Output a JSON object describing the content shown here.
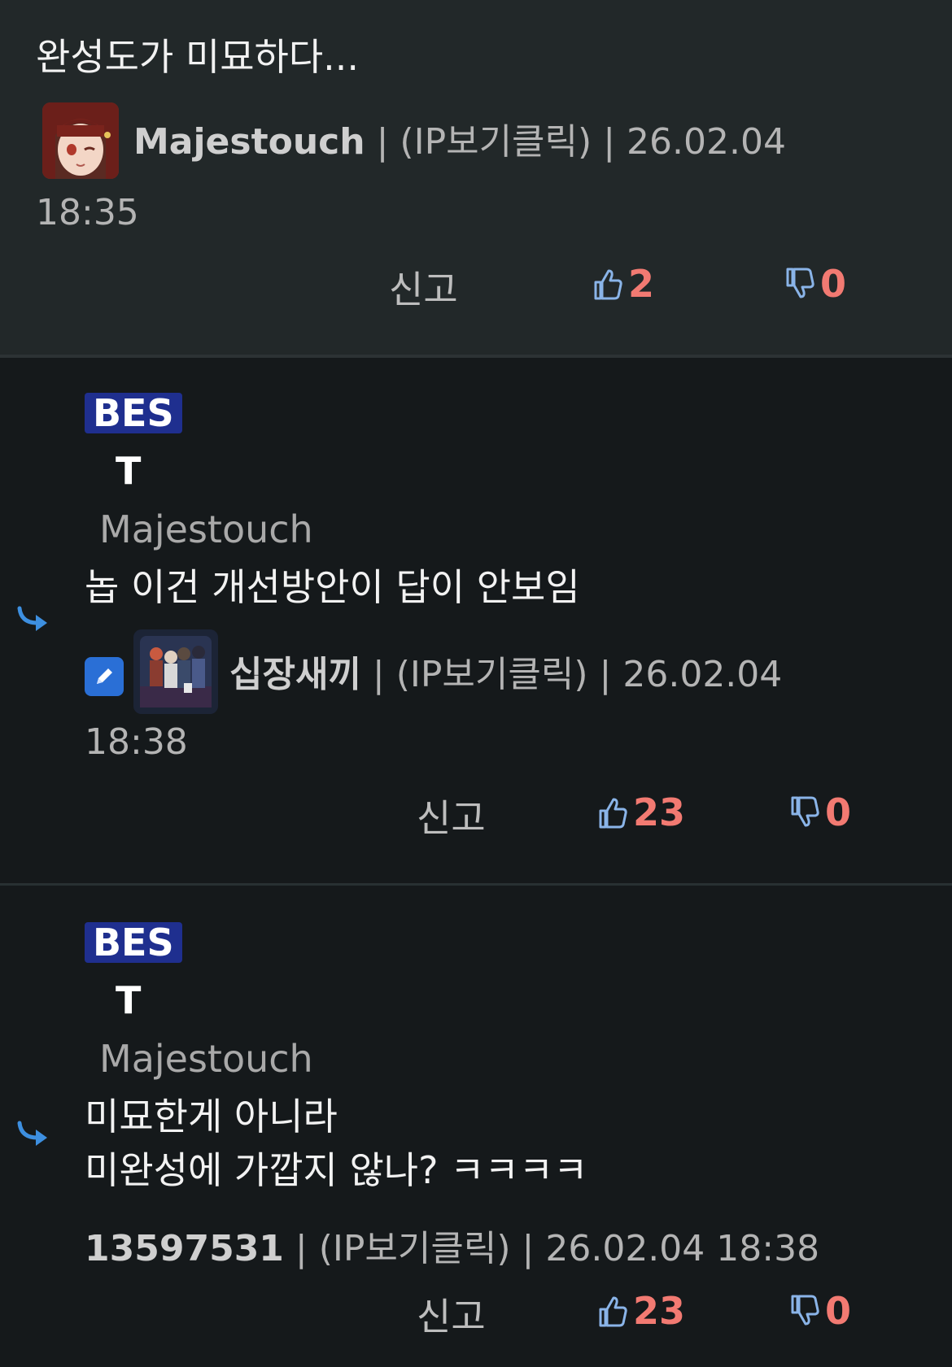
{
  "comments": [
    {
      "text_lines": [
        "완성도가 미묘하다..."
      ],
      "author": "Majestouch",
      "ip": "(IP보기클릭)",
      "date": "26.02.04",
      "time": "18:35",
      "report_label": "신고",
      "likes": "2",
      "dislikes": "0",
      "avatar_icon": "anime-girl-avatar"
    },
    {
      "badge": "BES",
      "badge_sub": "T",
      "reply_to": "Majestouch",
      "text_lines": [
        "놉 이건 개선방안이 답이 안보임"
      ],
      "author": "십장새끼",
      "ip": "(IP보기클릭)",
      "date": "26.02.04",
      "time": "18:38",
      "report_label": "신고",
      "likes": "23",
      "dislikes": "0",
      "avatar_icon": "group-illustration-avatar",
      "edit_icon": "pencil-icon"
    },
    {
      "badge": "BES",
      "badge_sub": "T",
      "reply_to": "Majestouch",
      "text_lines": [
        "미묘한게 아니라",
        "미완성에 가깝지 않나? ㅋㅋㅋㅋ"
      ],
      "author": "13597531",
      "ip": "(IP보기클릭)",
      "date": "26.02.04",
      "time": "18:38",
      "report_label": "신고",
      "likes": "23",
      "dislikes": "0"
    }
  ],
  "separator": "|",
  "colors": {
    "bg_top_comment": "#222829",
    "bg_reply": "#15191b",
    "count_red": "#f27a72",
    "thumb_blue": "#8ab4e8",
    "badge_blue": "#1f2f8f",
    "reply_arrow_blue": "#3d8fe0"
  }
}
